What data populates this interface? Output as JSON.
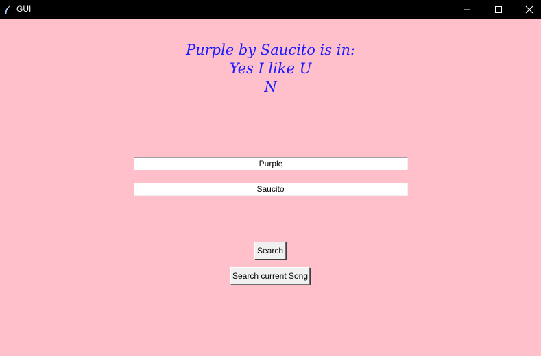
{
  "window": {
    "title": "GUI",
    "icon": "feather-icon",
    "controls": [
      "minimize-icon",
      "maximize-icon",
      "close-icon"
    ]
  },
  "result": {
    "line1": "Purple by Saucito is in:",
    "line2": "Yes I like U",
    "line3": "N"
  },
  "form": {
    "song_value": "Purple",
    "artist_value": "Saucito"
  },
  "buttons": {
    "search_label": "Search",
    "current_label": "Search current Song"
  },
  "colors": {
    "background": "#ffc0cb",
    "result_text": "#1a1aff",
    "titlebar": "#000000"
  }
}
